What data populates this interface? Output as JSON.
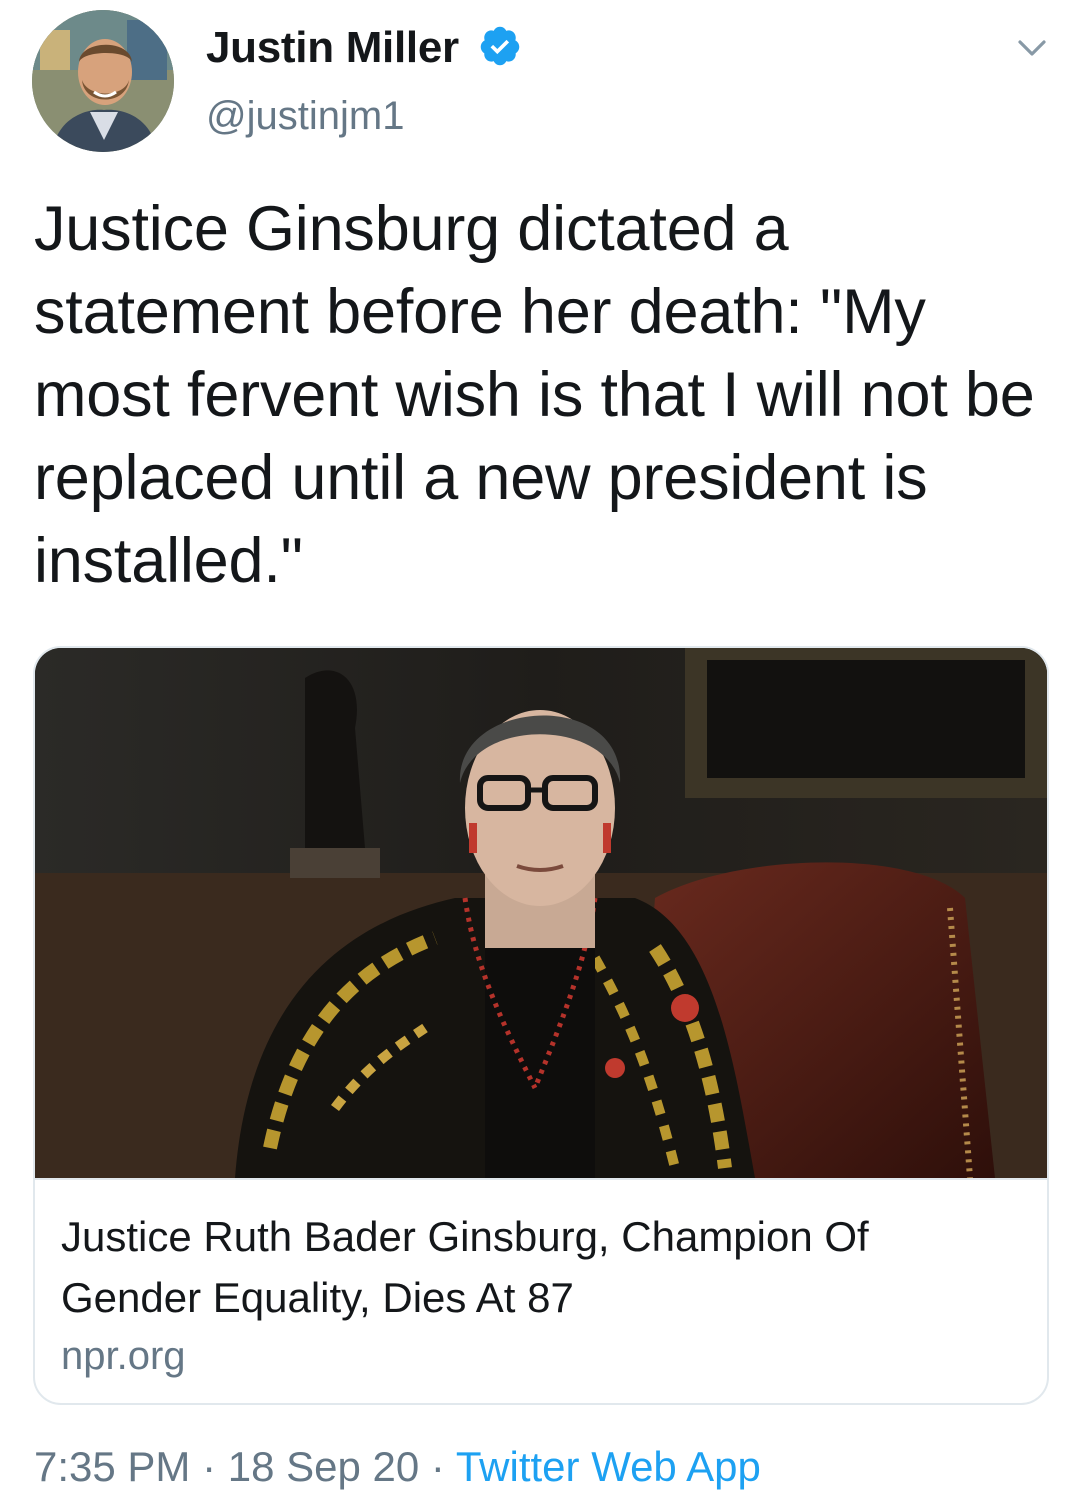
{
  "author": {
    "name": "Justin Miller",
    "handle": "@justinjm1",
    "verified_icon": "verified-badge-icon"
  },
  "tweet": {
    "text": "Justice Ginsburg dictated a statement before her death: \"My most fervent wish is that I will not be replaced until a new president is installed.\""
  },
  "card": {
    "title": "Justice Ruth Bader Ginsburg, Champion Of Gender Equality, Dies At 87",
    "domain": "npr.org"
  },
  "meta": {
    "time": "7:35 PM",
    "separator": " · ",
    "date": "18 Sep 20",
    "source": "Twitter Web App"
  },
  "colors": {
    "text": "#14171a",
    "secondary": "#657786",
    "link": "#1da1f2",
    "border": "#e1e8ed"
  }
}
